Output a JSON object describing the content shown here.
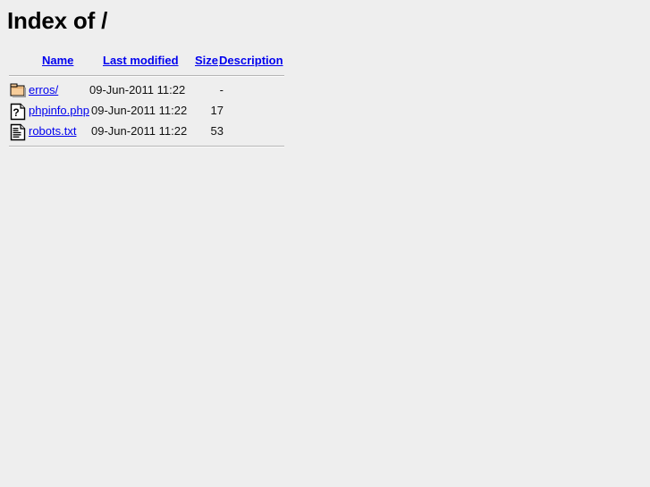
{
  "page": {
    "title_prefix": "Index of",
    "path": "/",
    "title": "Index of /",
    "background_color": "#eeeeee",
    "link_color": "#0000ee",
    "text_color": "#000000"
  },
  "table": {
    "headers": [
      {
        "label": "Name",
        "icon": "sort-name-link"
      },
      {
        "label": "Last modified",
        "icon": "sort-date-link"
      },
      {
        "label": "Size",
        "icon": "sort-size-link"
      },
      {
        "label": "Description",
        "icon": "sort-description-link"
      }
    ],
    "rows": [
      {
        "icon": "folder-icon",
        "icon_alt": "[DIR]",
        "name": "erros/",
        "last_modified": "09-Jun-2011 11:22",
        "size": "-",
        "description": ""
      },
      {
        "icon": "unknown-file-icon",
        "icon_alt": "[   ]",
        "name": "phpinfo.php",
        "last_modified": "09-Jun-2011 11:22",
        "size": "17",
        "description": ""
      },
      {
        "icon": "text-file-icon",
        "icon_alt": "[TXT]",
        "name": "robots.txt",
        "last_modified": "09-Jun-2011 11:22",
        "size": "53",
        "description": ""
      }
    ]
  }
}
